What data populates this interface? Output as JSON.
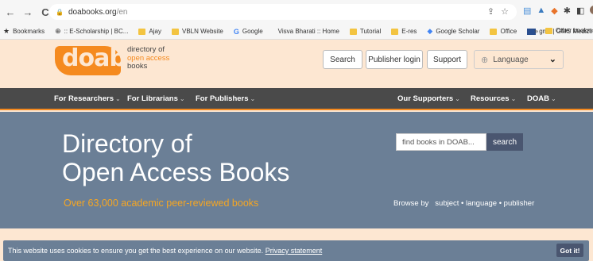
{
  "browser": {
    "url_host": "doabooks.org",
    "url_path": "/en",
    "nav": {
      "back": "←",
      "forward": "→",
      "reload": "C"
    }
  },
  "bookmarks": {
    "items": [
      {
        "label": "Bookmarks",
        "icon": "star-icon"
      },
      {
        "label": ":: E-Scholarship | BC...",
        "icon": "globe-icon"
      },
      {
        "label": "Ajay",
        "icon": "folder-icon"
      },
      {
        "label": "VBLN Website",
        "icon": "folder-icon"
      },
      {
        "label": "Google",
        "icon": "google-icon"
      },
      {
        "label": "Visva Bharati :: Home",
        "icon": "site-icon"
      },
      {
        "label": "Tutorial",
        "icon": "folder-icon"
      },
      {
        "label": "E-res",
        "icon": "folder-icon"
      },
      {
        "label": "Google Scholar",
        "icon": "scholar-icon"
      },
      {
        "label": "Office",
        "icon": "folder-icon"
      },
      {
        "label": "gms | GMS Medizin...",
        "icon": "gms-icon"
      }
    ],
    "more": "»",
    "other": "Other bookmarks"
  },
  "site": {
    "logo": "doab",
    "tagline": [
      "directory of",
      "open access",
      "books"
    ],
    "buttons": {
      "search": "Search",
      "publisher_login": "Publisher login",
      "support": "Support",
      "language": "Language"
    },
    "nav_left": [
      "For Researchers",
      "For Librarians",
      "For Publishers"
    ],
    "nav_right": [
      "Our Supporters",
      "Resources",
      "DOAB"
    ],
    "hero_title": [
      "Directory of",
      "Open Access Books"
    ],
    "hero_subtitle": "Over 63,000 academic peer-reviewed books",
    "search_placeholder": "find books in DOAB...",
    "search_button": "search",
    "browse_label": "Browse by",
    "browse_links": "subject • language • publisher",
    "cookie_text": "This website uses cookies to ensure you get the best experience on our website.",
    "cookie_link": "Privacy statement",
    "cookie_button": "Got it!"
  },
  "colors": {
    "accent_orange": "#f58a1f",
    "page_bg": "#fde7d2",
    "nav_bg": "#4a4a4a",
    "hero_bg": "#6b7f96",
    "button_dark": "#4a5670"
  }
}
